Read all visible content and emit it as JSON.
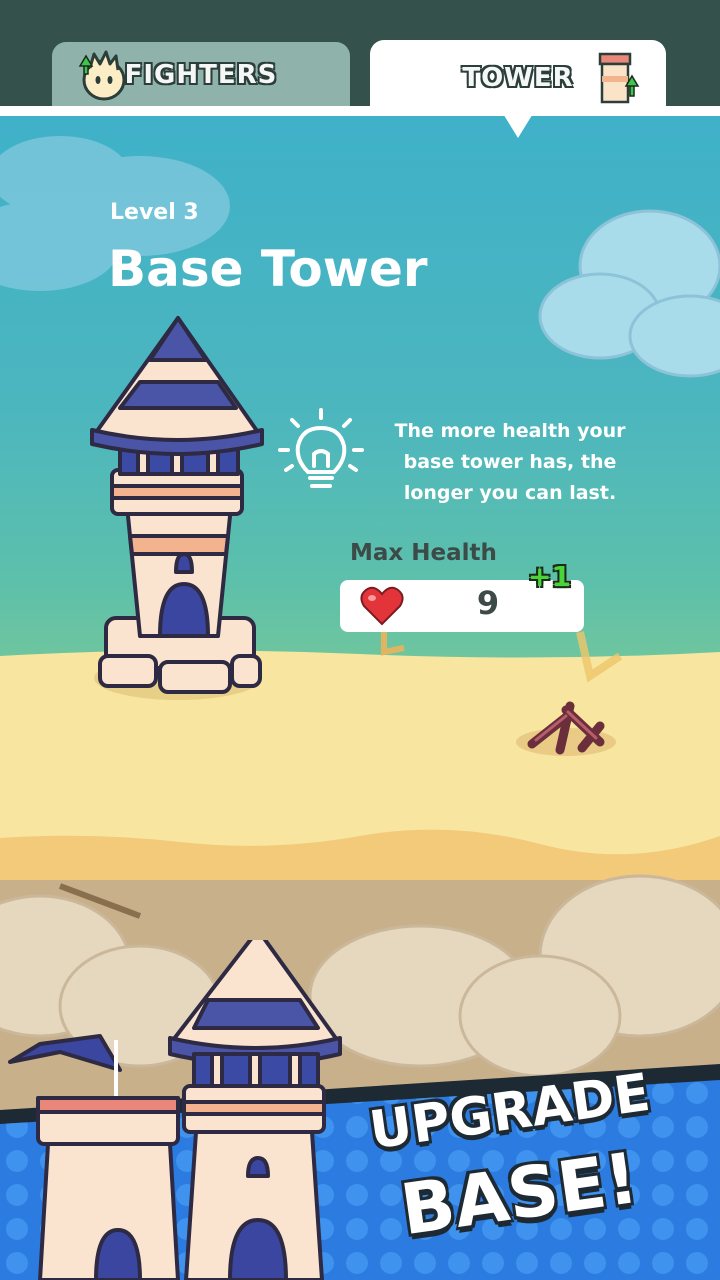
{
  "tabs": {
    "fighters_label": "FIGHTERS",
    "tower_label": "TOWER",
    "active": "TOWER"
  },
  "tower": {
    "level": "Level 3",
    "name": "Base Tower",
    "tip": "The more health your base tower has, the longer you can last.",
    "stat_label": "Max Health",
    "stat_value": "9",
    "stat_bonus": "+1"
  },
  "promo": {
    "line1": "UPGRADE",
    "line2": "BASE!"
  },
  "colors": {
    "sky_top": "#3fb1c8",
    "sand": "#f7e5a0",
    "tower_roof": "#4a55a8",
    "bonus_green": "#49d437",
    "banner_blue": "#2b7be0"
  },
  "icons": [
    "fighter-upgrade-icon",
    "tower-upgrade-icon",
    "lightbulb-icon",
    "heart-icon",
    "campfire-icon"
  ]
}
